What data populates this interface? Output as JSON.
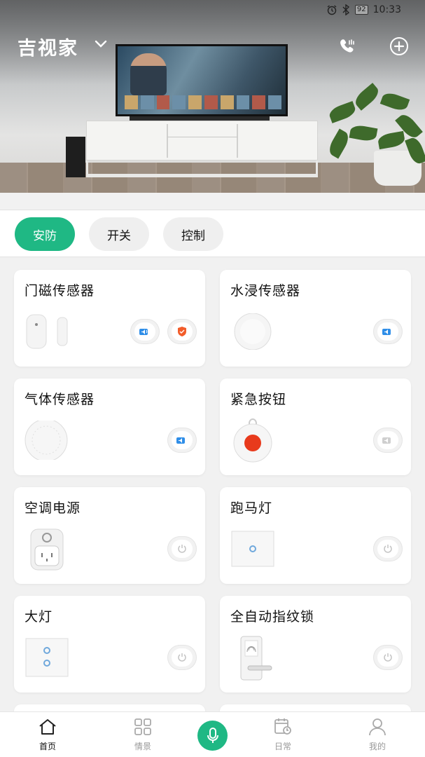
{
  "status_bar": {
    "time": "10:33",
    "battery": "92",
    "icons": [
      "alarm-icon",
      "bluetooth-icon",
      "battery-icon"
    ]
  },
  "header": {
    "title": "吉视家",
    "icons": [
      "chevron-down-icon",
      "phone-icon",
      "add-circle-icon"
    ]
  },
  "tabs": [
    {
      "label": "安防",
      "active": true
    },
    {
      "label": "开关",
      "active": false
    },
    {
      "label": "控制",
      "active": false
    }
  ],
  "devices": [
    {
      "name": "门磁传感器",
      "actions": [
        "speaker-icon",
        "shield-icon"
      ]
    },
    {
      "name": "水浸传感器",
      "actions": [
        "speaker-icon"
      ]
    },
    {
      "name": "气体传感器",
      "actions": [
        "speaker-icon"
      ]
    },
    {
      "name": "紧急按钮",
      "actions": [
        "speaker-icon"
      ],
      "disabled": true
    },
    {
      "name": "空调电源",
      "actions": [
        "power-icon"
      ]
    },
    {
      "name": "跑马灯",
      "actions": [
        "power-icon"
      ]
    },
    {
      "name": "大灯",
      "actions": [
        "power-icon"
      ]
    },
    {
      "name": "全自动指纹锁",
      "actions": [
        "power-icon"
      ]
    }
  ],
  "bottom_nav": [
    {
      "label": "首页",
      "icon": "home-icon",
      "active": true
    },
    {
      "label": "情景",
      "icon": "grid-icon",
      "active": false
    },
    {
      "label": "",
      "icon": "mic-icon",
      "active": false
    },
    {
      "label": "日常",
      "icon": "calendar-clock-icon",
      "active": false
    },
    {
      "label": "我的",
      "icon": "user-icon",
      "active": false
    }
  ],
  "colors": {
    "accent": "#1fb884",
    "sound_blue": "#2f8ee8",
    "shield_orange": "#f25c2a",
    "button_red": "#e83a1c"
  }
}
